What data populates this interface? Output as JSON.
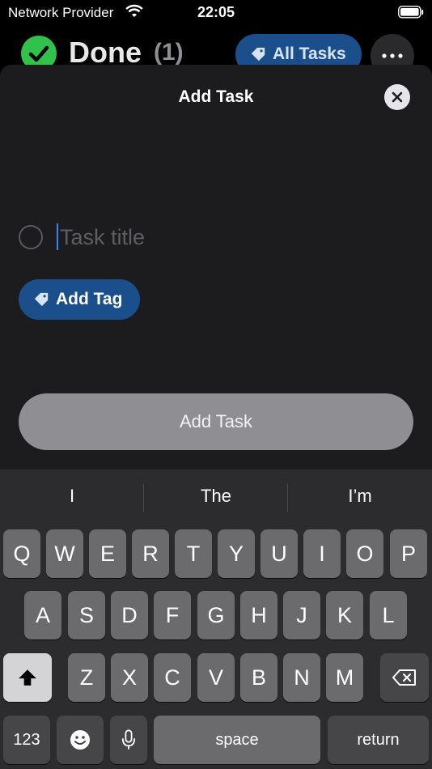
{
  "status_bar": {
    "carrier": "Network Provider",
    "time": "22:05"
  },
  "background": {
    "list_title": "Done",
    "count": "(1)",
    "filter_label": "All Tasks"
  },
  "sheet": {
    "title": "Add Task",
    "task_placeholder": "Task title",
    "task_value": "",
    "add_tag_label": "Add Tag",
    "add_task_button": "Add Task"
  },
  "keyboard": {
    "suggestions": [
      "I",
      "The",
      "I’m"
    ],
    "row1": [
      "Q",
      "W",
      "E",
      "R",
      "T",
      "Y",
      "U",
      "I",
      "O",
      "P"
    ],
    "row2": [
      "A",
      "S",
      "D",
      "F",
      "G",
      "H",
      "J",
      "K",
      "L"
    ],
    "row3": [
      "Z",
      "X",
      "C",
      "V",
      "B",
      "N",
      "M"
    ],
    "numbers_key": "123",
    "space_key": "space",
    "return_key": "return"
  },
  "colors": {
    "accent_blue": "#1b4f8c",
    "done_green": "#30c24a",
    "sheet_bg": "#1c1c1e"
  }
}
